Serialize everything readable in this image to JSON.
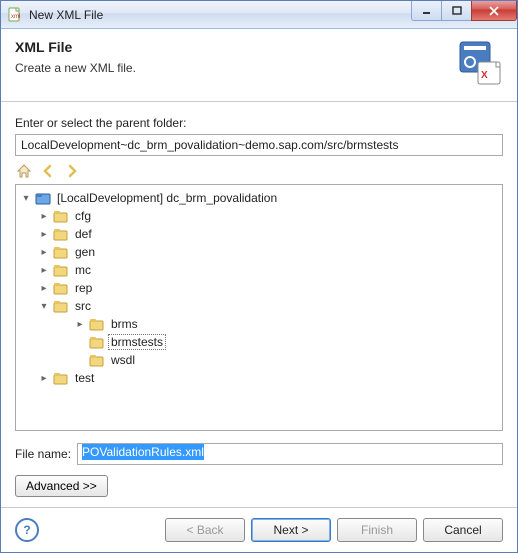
{
  "window": {
    "title": "New XML File"
  },
  "header": {
    "title": "XML File",
    "subtitle": "Create a new XML file."
  },
  "labels": {
    "parent": "Enter or select the parent folder:",
    "filename": "File name:"
  },
  "path_value": "LocalDevelopment~dc_brm_povalidation~demo.sap.com/src/brmstests",
  "tree": {
    "root": "[LocalDevelopment] dc_brm_povalidation",
    "n_cfg": "cfg",
    "n_def": "def",
    "n_gen": "gen",
    "n_mc": "mc",
    "n_rep": "rep",
    "n_src": "src",
    "n_brms": "brms",
    "n_brmstests": "brmstests",
    "n_wsdl": "wsdl",
    "n_test": "test"
  },
  "filename_value": "POValidationRules.xml",
  "buttons": {
    "advanced": "Advanced >>",
    "back": "< Back",
    "next": "Next >",
    "finish": "Finish",
    "cancel": "Cancel"
  }
}
